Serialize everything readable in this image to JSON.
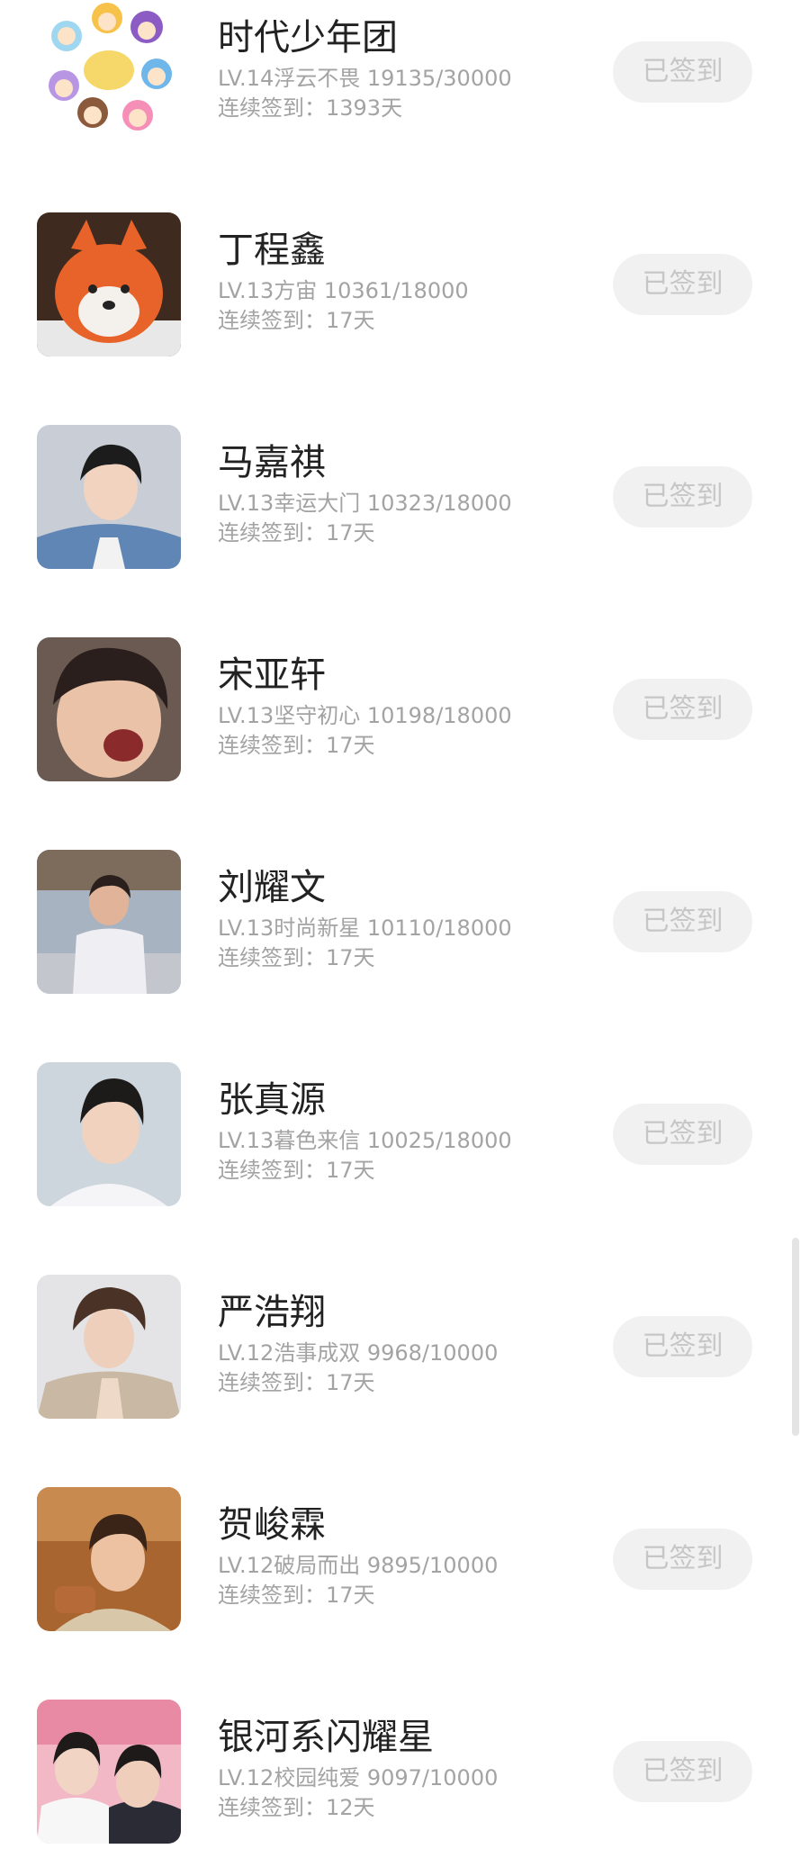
{
  "checkin_list": {
    "items": [
      {
        "name": "时代少年团",
        "level": "LV.14浮云不畏 19135/30000",
        "streak_label": "连续签到：",
        "streak_value": "1393天",
        "status": "已签到"
      },
      {
        "name": "丁程鑫",
        "level": "LV.13方宙 10361/18000",
        "streak_label": "连续签到：",
        "streak_value": "17天",
        "status": "已签到"
      },
      {
        "name": "马嘉祺",
        "level": "LV.13幸运大门 10323/18000",
        "streak_label": "连续签到：",
        "streak_value": "17天",
        "status": "已签到"
      },
      {
        "name": "宋亚轩",
        "level": "LV.13坚守初心 10198/18000",
        "streak_label": "连续签到：",
        "streak_value": "17天",
        "status": "已签到"
      },
      {
        "name": "刘耀文",
        "level": "LV.13时尚新星 10110/18000",
        "streak_label": "连续签到：",
        "streak_value": "17天",
        "status": "已签到"
      },
      {
        "name": "张真源",
        "level": "LV.13暮色来信 10025/18000",
        "streak_label": "连续签到：",
        "streak_value": "17天",
        "status": "已签到"
      },
      {
        "name": "严浩翔",
        "level": "LV.12浩事成双 9968/10000",
        "streak_label": "连续签到：",
        "streak_value": "17天",
        "status": "已签到"
      },
      {
        "name": "贺峻霖",
        "level": "LV.12破局而出 9895/10000",
        "streak_label": "连续签到：",
        "streak_value": "17天",
        "status": "已签到"
      },
      {
        "name": "银河系闪耀星",
        "level": "LV.12校园纯爱 9097/10000",
        "streak_label": "连续签到：",
        "streak_value": "12天",
        "status": "已签到"
      }
    ]
  },
  "colors": {
    "name_text": "#222222",
    "meta_text": "#a3a3a3",
    "button_bg": "#f1f1f1",
    "button_text": "#c6c6c6"
  }
}
